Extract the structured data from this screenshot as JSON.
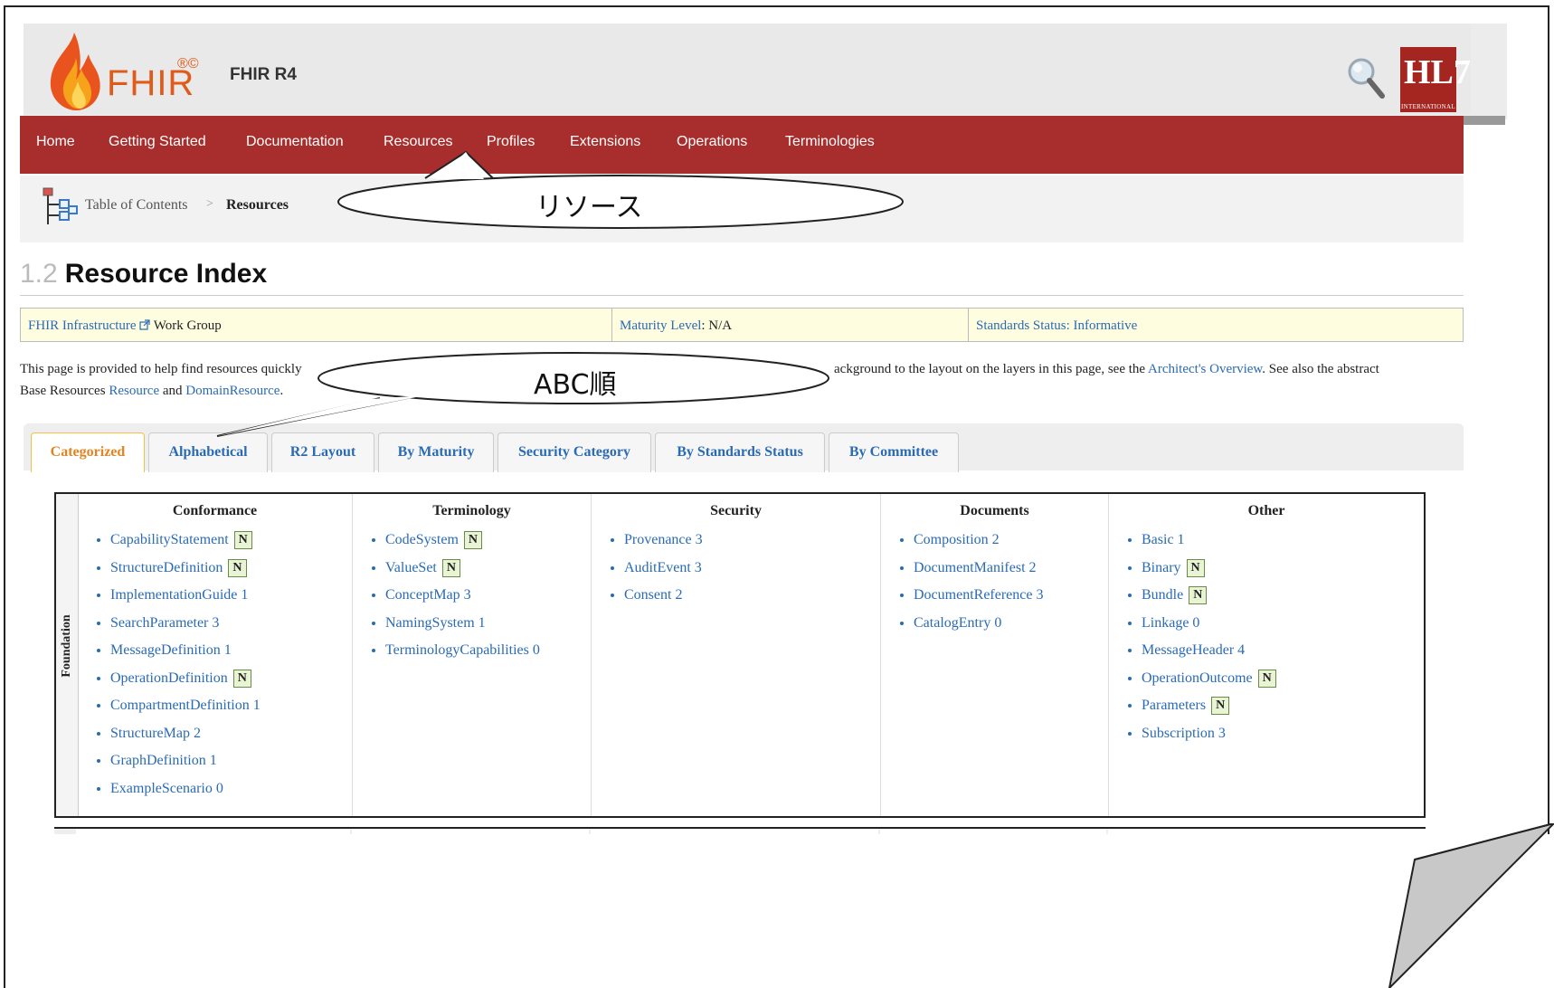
{
  "header": {
    "logo_text": "FHIR",
    "logo_reg": "®©",
    "title": "FHIR R4",
    "hl7_logo_text": "HL7",
    "hl7_logo_sub": "INTERNATIONAL"
  },
  "nav": {
    "items": [
      "Home",
      "Getting Started",
      "Documentation",
      "Resources",
      "Profiles",
      "Extensions",
      "Operations",
      "Terminologies"
    ]
  },
  "breadcrumb": {
    "toc": "Table of Contents",
    "separator": ">",
    "current": "Resources"
  },
  "page": {
    "title_num": "1.2",
    "title": "Resource Index"
  },
  "info": {
    "workgroup_link": "FHIR Infrastructure",
    "workgroup_suffix": "Work Group",
    "maturity_label": "Maturity Level",
    "maturity_value": ": N/A",
    "status_label": "Standards Status",
    "status_value": "Informative"
  },
  "intro": {
    "part1": "This page is provided to help find resources quickly",
    "part2": "ackground to the layout on the layers in this page, see the",
    "architect_link": "Architect's Overview",
    "part3": ". See also the abstract",
    "line2_prefix": "Base Resources",
    "resource_link": "Resource",
    "and": "and",
    "domain_link": "DomainResource",
    "end": "."
  },
  "tabs": [
    {
      "label": "Categorized",
      "active": true
    },
    {
      "label": "Alphabetical",
      "active": false
    },
    {
      "label": "R2 Layout",
      "active": false
    },
    {
      "label": "By Maturity",
      "active": false
    },
    {
      "label": "Security Category",
      "active": false
    },
    {
      "label": "By Standards Status",
      "active": false
    },
    {
      "label": "By Committee",
      "active": false
    }
  ],
  "grid": {
    "row_label": "Foundation",
    "columns": [
      {
        "header": "Conformance",
        "items": [
          {
            "name": "CapabilityStatement",
            "level": "N"
          },
          {
            "name": "StructureDefinition",
            "level": "N"
          },
          {
            "name": "ImplementationGuide 1",
            "level": ""
          },
          {
            "name": "SearchParameter 3",
            "level": ""
          },
          {
            "name": "MessageDefinition 1",
            "level": ""
          },
          {
            "name": "OperationDefinition",
            "level": "N"
          },
          {
            "name": "CompartmentDefinition 1",
            "level": ""
          },
          {
            "name": "StructureMap 2",
            "level": ""
          },
          {
            "name": "GraphDefinition 1",
            "level": ""
          },
          {
            "name": "ExampleScenario 0",
            "level": ""
          }
        ]
      },
      {
        "header": "Terminology",
        "items": [
          {
            "name": "CodeSystem",
            "level": "N"
          },
          {
            "name": "ValueSet",
            "level": "N"
          },
          {
            "name": "ConceptMap 3",
            "level": ""
          },
          {
            "name": "NamingSystem 1",
            "level": ""
          },
          {
            "name": "TerminologyCapabilities 0",
            "level": ""
          }
        ]
      },
      {
        "header": "Security",
        "items": [
          {
            "name": "Provenance 3",
            "level": ""
          },
          {
            "name": "AuditEvent 3",
            "level": ""
          },
          {
            "name": "Consent 2",
            "level": ""
          }
        ]
      },
      {
        "header": "Documents",
        "items": [
          {
            "name": "Composition 2",
            "level": ""
          },
          {
            "name": "DocumentManifest 2",
            "level": ""
          },
          {
            "name": "DocumentReference 3",
            "level": ""
          },
          {
            "name": "CatalogEntry 0",
            "level": ""
          }
        ]
      },
      {
        "header": "Other",
        "items": [
          {
            "name": "Basic 1",
            "level": ""
          },
          {
            "name": "Binary",
            "level": "N"
          },
          {
            "name": "Bundle",
            "level": "N"
          },
          {
            "name": "Linkage 0",
            "level": ""
          },
          {
            "name": "MessageHeader 4",
            "level": ""
          },
          {
            "name": "OperationOutcome",
            "level": "N"
          },
          {
            "name": "Parameters",
            "level": "N"
          },
          {
            "name": "Subscription 3",
            "level": ""
          }
        ]
      }
    ]
  },
  "callouts": {
    "resources": "リソース",
    "alphabetical": "ABC順"
  },
  "colors": {
    "nav_bg": "#a72e2c",
    "link": "#2a6bb3",
    "active_tab": "#e28421",
    "info_bg": "#fffde0"
  }
}
